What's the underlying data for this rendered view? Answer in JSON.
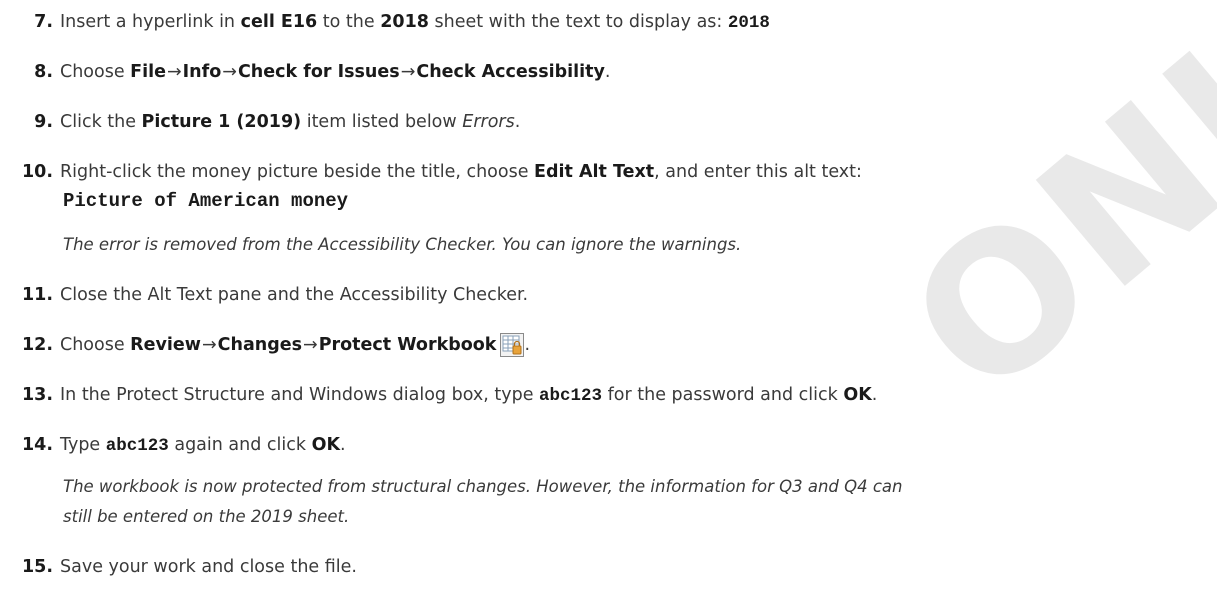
{
  "watermark": "ONLY",
  "steps": {
    "s7": {
      "num": "7.",
      "a": "Insert a hyperlink in ",
      "b1": "cell E16",
      "c": " to the ",
      "b2": "2018",
      "d": " sheet with the text to display as: ",
      "code": "2018"
    },
    "s8": {
      "num": "8.",
      "a": "Choose ",
      "m1": "File",
      "m2": "Info",
      "m3": "Check for Issues",
      "m4": "Check Accessibility",
      "end": ".",
      "arrow": "→"
    },
    "s9": {
      "num": "9.",
      "a": "Click the ",
      "b1": "Picture 1 (2019)",
      "c": " item listed below ",
      "it": "Errors",
      "end": "."
    },
    "s10": {
      "num": "10.",
      "a": "Right-click the money picture beside the title, choose ",
      "b1": "Edit Alt Text",
      "c": ", and enter this alt text:",
      "code": "Picture of American money",
      "note": "The error is removed from the Accessibility Checker. You can ignore the warnings."
    },
    "s11": {
      "num": "11.",
      "a": "Close the Alt Text pane and the Accessibility Checker."
    },
    "s12": {
      "num": "12.",
      "a": "Choose ",
      "m1": "Review",
      "m2": "Changes",
      "m3": "Protect Workbook",
      "end": ".",
      "arrow": "→",
      "icon": "protect-workbook-icon"
    },
    "s13": {
      "num": "13.",
      "a": "In the Protect Structure and Windows dialog box, type ",
      "code": "abc123",
      "c": " for the password and click ",
      "b1": "OK",
      "end": "."
    },
    "s14": {
      "num": "14.",
      "a": "Type ",
      "code": "abc123",
      "c": " again and click ",
      "b1": "OK",
      "end": ".",
      "note1": "The workbook is now protected from structural changes. However, the information for Q3 and Q4 can",
      "note2": "still be entered on the 2019 sheet."
    },
    "s15": {
      "num": "15.",
      "a": "Save your work and close the file."
    }
  }
}
